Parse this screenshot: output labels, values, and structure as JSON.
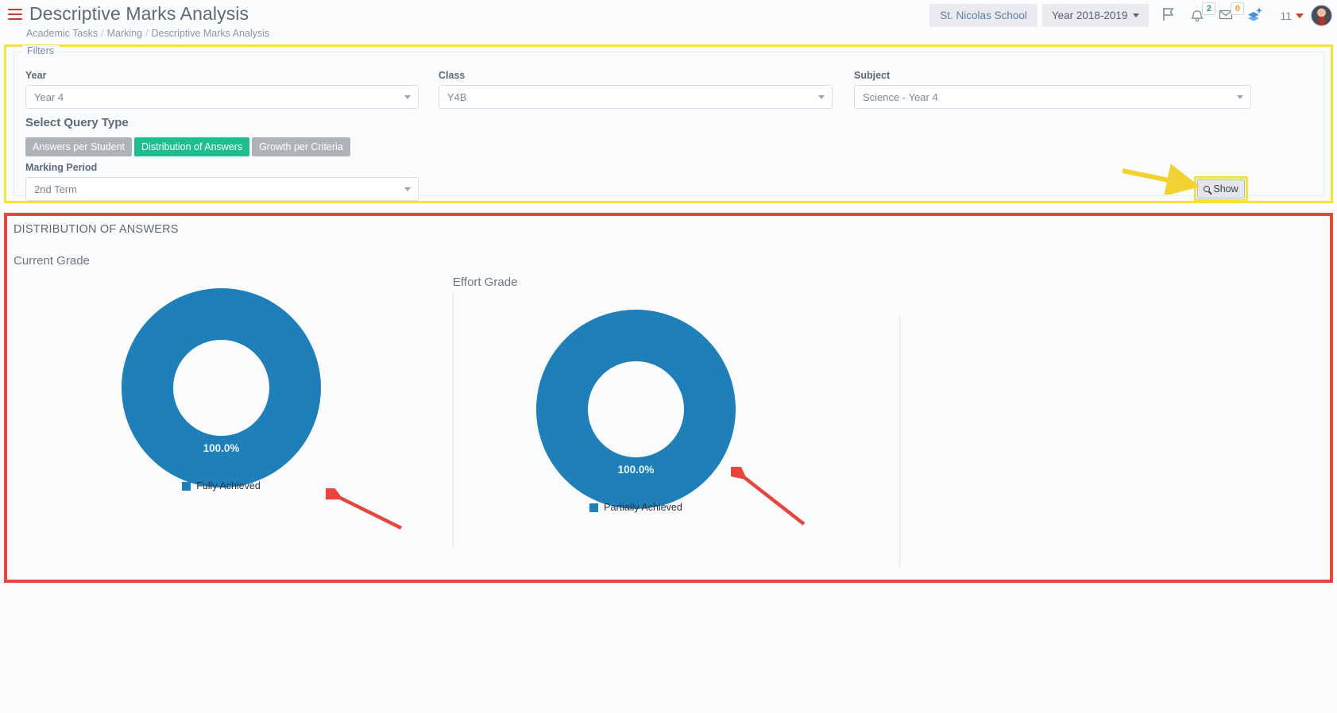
{
  "header": {
    "menu_icon": "hamburger-icon",
    "title": "Descriptive Marks Analysis",
    "breadcrumb": [
      "Academic Tasks",
      "Marking",
      "Descriptive Marks Analysis"
    ],
    "separator": "/",
    "school": "St. Nicolas School",
    "academic_year": "Year 2018-2019",
    "icons": [
      "flag-icon",
      "bell-icon",
      "envelope-icon",
      "layers-add-icon"
    ],
    "bell_badge": "2",
    "envelope_badge": "0",
    "user_count": "11"
  },
  "filters": {
    "legend": "Filters",
    "year": {
      "label": "Year",
      "value": "Year 4"
    },
    "class": {
      "label": "Class",
      "value": "Y4B"
    },
    "subject": {
      "label": "Subject",
      "value": "Science - Year 4"
    },
    "query_type": {
      "label": "Select Query Type",
      "buttons": [
        {
          "label": "Answers per Student",
          "active": false
        },
        {
          "label": "Distribution of Answers",
          "active": true
        },
        {
          "label": "Growth per Criteria",
          "active": false
        }
      ]
    },
    "marking_period": {
      "label": "Marking Period",
      "value": "2nd Term"
    },
    "show_button": "Show"
  },
  "results": {
    "title": "DISTRIBUTION OF ANSWERS",
    "panels": [
      {
        "title": "Current Grade"
      },
      {
        "title": "Effort Grade"
      }
    ]
  },
  "chart_data": [
    {
      "type": "pie",
      "title": "Current Grade",
      "variant": "donut",
      "labels": [
        "Fully Achieved"
      ],
      "values": [
        100.0
      ],
      "data_labels": [
        "100.0%"
      ],
      "colors": [
        "#1f7fb8"
      ],
      "legend_position": "bottom",
      "units": "percent"
    },
    {
      "type": "pie",
      "title": "Effort Grade",
      "variant": "donut",
      "labels": [
        "Partially Achieved"
      ],
      "values": [
        100.0
      ],
      "data_labels": [
        "100.0%"
      ],
      "colors": [
        "#1f7fb8"
      ],
      "legend_position": "bottom",
      "units": "percent"
    }
  ],
  "annotations": {
    "show_arrow": "yellow-arrow-pointing-to-show-button",
    "chart1_arrow": "red-arrow-pointing-to-current-grade-chart",
    "chart2_arrow": "red-arrow-pointing-to-effort-grade-chart",
    "filters_highlight_color": "#f5e03c",
    "results_highlight_color": "#e8453c"
  }
}
